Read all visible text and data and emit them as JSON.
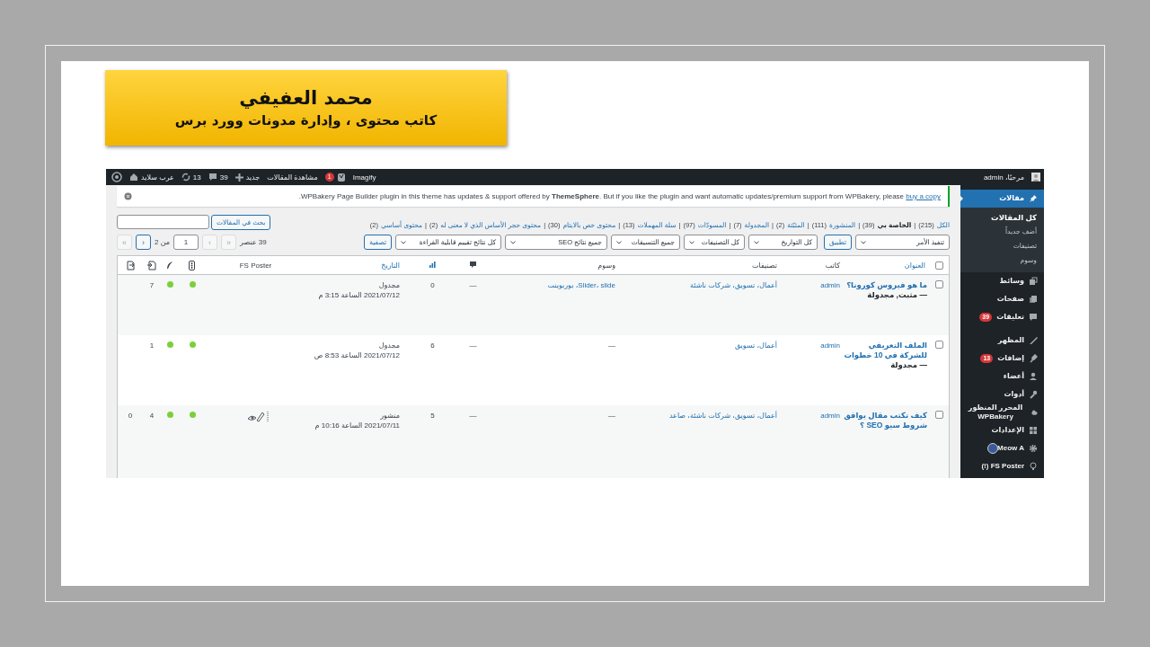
{
  "hero": {
    "name": "محمد العفيفي",
    "tagline": "كاتب محتوى ، وإدارة مدونات وورد برس"
  },
  "admin_bar": {
    "site": "عرب سلايد",
    "updates": "13",
    "comments": "39",
    "new": "جديد",
    "view_posts": "مشاهدة المقالات",
    "notifications": "1",
    "imagify": "Imagify",
    "greeting": "مرحبًا، admin"
  },
  "sidebar": {
    "groups": [
      {
        "items": [
          {
            "label": "مقالات",
            "selected": true,
            "children": [
              {
                "label": "كل المقالات",
                "selected": true
              },
              {
                "label": "أضف جديداً",
                "selected": false
              },
              {
                "label": "تصنيفات",
                "selected": false
              },
              {
                "label": "وسوم",
                "selected": false
              }
            ]
          },
          {
            "label": "وسائط",
            "selected": false
          },
          {
            "label": "صفحات",
            "selected": false
          },
          {
            "label": "تعليقات",
            "selected": false,
            "badge": "39"
          }
        ]
      },
      {
        "items": [
          {
            "label": "المظهر",
            "selected": false
          },
          {
            "label": "إضافات",
            "selected": false,
            "badge": "13"
          },
          {
            "label": "أعضاء",
            "selected": false
          },
          {
            "label": "أدوات",
            "selected": false
          },
          {
            "label": "المحرر المنظور WPBakery",
            "selected": false
          },
          {
            "label": "الإعدادات",
            "selected": false
          },
          {
            "label": "Meow A",
            "selected": false
          },
          {
            "label": "FS Poster (!)",
            "selected": false
          }
        ]
      }
    ]
  },
  "notice": {
    "text": "WPBakery Page Builder plugin in this theme has updates & support offered by **ThemeSphere**. But if you like the plugin and want automatic updates/premium support from WPBakery, please ",
    "link": "buy a copy",
    "end": "."
  },
  "views": {
    "separator": "|",
    "items": [
      {
        "label": "الكل",
        "count": "(215)",
        "selected": false
      },
      {
        "label": "الخاصة بي",
        "count": "(39)",
        "selected": true
      },
      {
        "label": "المنشورة",
        "count": "(111)",
        "selected": false
      },
      {
        "label": "المثبّتة",
        "count": "(2)",
        "selected": false
      },
      {
        "label": "المجدولة",
        "count": "(7)",
        "selected": false
      },
      {
        "label": "المسودّات",
        "count": "(97)",
        "selected": false
      },
      {
        "label": "سلة المهملات",
        "count": "(13)",
        "selected": false
      },
      {
        "label": "محتوى خص بالايتام",
        "count": "(30)",
        "selected": false
      },
      {
        "label": "محتوى حجر الأساس الذي لا معنى له",
        "count": "(2)",
        "selected": false
      },
      {
        "label": "محتوى أساسي",
        "count": "(2)",
        "selected": false
      }
    ]
  },
  "search": {
    "button": "بحث في المقالات"
  },
  "filters": {
    "bulk": "تنفيذ الأمر",
    "apply": "تطبيق",
    "selects": [
      "كل التواريخ",
      "كل التصنيفات",
      "جميع التنسيقات",
      "جميع نتائج SEO",
      "كل نتائج تقييم قابلية القراءة"
    ],
    "filter": "تصفية"
  },
  "pagination": {
    "count": "39 عنصر",
    "first": {
      "label": "»",
      "disabled": true
    },
    "prev": {
      "label": "‹",
      "disabled": true
    },
    "page": "1",
    "of": "من 2",
    "next": {
      "label": "›",
      "disabled": false
    },
    "last": {
      "label": "«",
      "disabled": true
    }
  },
  "table": {
    "columns": [
      {
        "kind": "checkbox",
        "checked": false
      },
      {
        "kind": "link",
        "label": "العنوان"
      },
      {
        "kind": "text",
        "label": "كاتب"
      },
      {
        "kind": "text",
        "label": "تصنيفات"
      },
      {
        "kind": "text",
        "label": "وسوم"
      },
      {
        "kind": "icon"
      },
      {
        "kind": "icon"
      },
      {
        "kind": "link",
        "label": "التاريخ"
      },
      {
        "kind": "text",
        "label": "FS Poster"
      },
      {
        "kind": "icon"
      },
      {
        "kind": "icon"
      },
      {
        "kind": "icon"
      },
      {
        "kind": "icon"
      }
    ],
    "rows": [
      {
        "checked": false,
        "title": "ما هو فيروس كورونا؟",
        "state": "— مثبت, مجدولة",
        "author": "admin",
        "categories": "أعمال، تسويق، شركات ناشئة",
        "tags": "Slider، slide، بوربوينت",
        "comments": "—",
        "views": "0",
        "status": "مجدول",
        "date": "2021/07/12 الساعة 3:15 م",
        "shared": false,
        "readability": {
          "color": "#7ad03a"
        },
        "seo": {
          "color": "#7ad03a"
        },
        "links_in": "7"
      },
      {
        "checked": false,
        "title": "الملف التعريفي للشركة في 10 خطوات",
        "state": "— مجدولة",
        "author": "admin",
        "categories": "أعمال، تسويق",
        "tags": "—",
        "comments": "—",
        "views": "6",
        "status": "مجدول",
        "date": "2021/07/12 الساعة 8:53 ص",
        "shared": false,
        "readability": {
          "color": "#7ad03a"
        },
        "seo": {
          "color": "#7ad03a"
        },
        "links_in": "1"
      },
      {
        "checked": false,
        "title": "كيف تكتب مقال يوافق شروط سيو SEO ؟",
        "author": "admin",
        "categories": "أعمال، تسويق، شركات ناشئة، صاعد",
        "tags": "—",
        "comments": "—",
        "views": "5",
        "status": "منشور",
        "date": "2021/07/11 الساعة 10:16 م",
        "shared": true,
        "readability": {
          "color": "#7ad03a"
        },
        "seo": {
          "color": "#7ad03a"
        },
        "links_in": "4",
        "links_out": "0"
      }
    ]
  }
}
